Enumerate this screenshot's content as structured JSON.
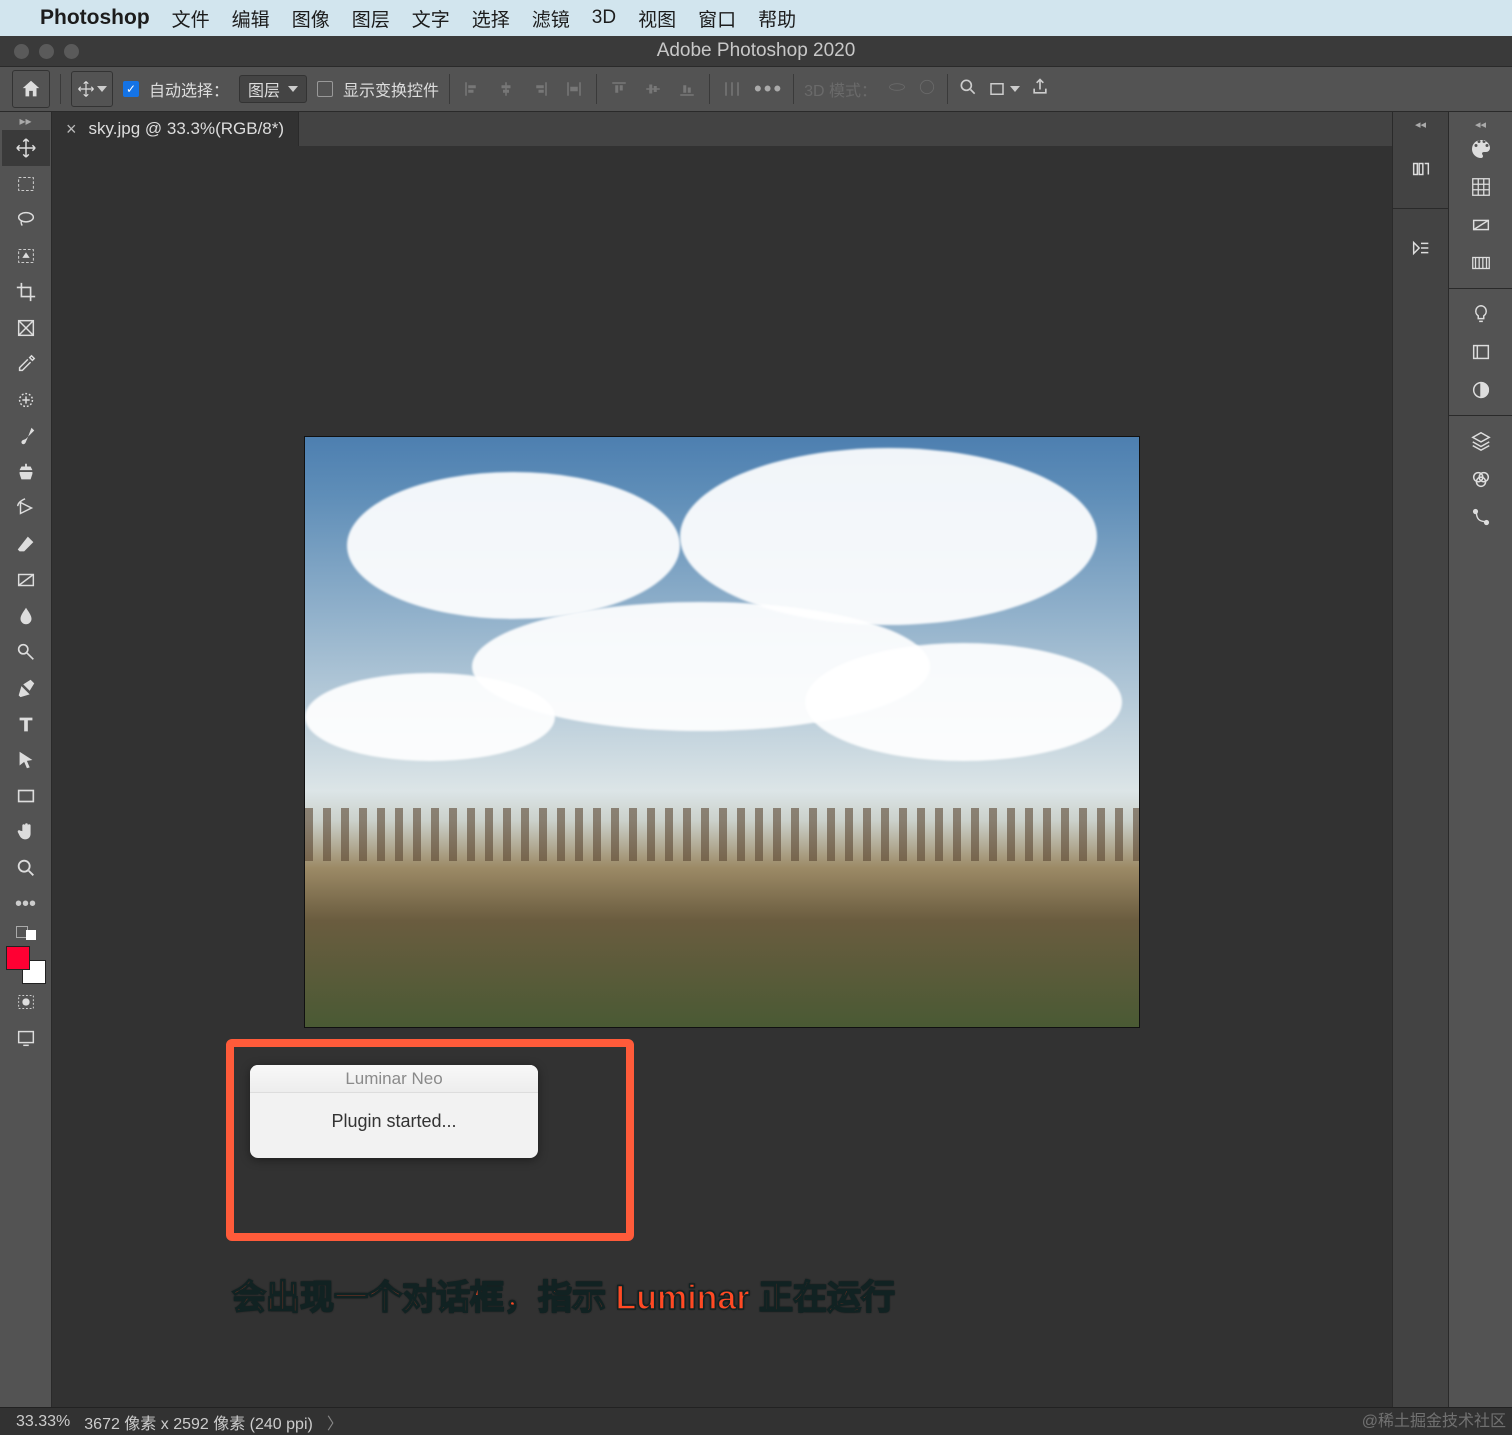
{
  "mac_menu": {
    "app_name": "Photoshop",
    "items": [
      "文件",
      "编辑",
      "图像",
      "图层",
      "文字",
      "选择",
      "滤镜",
      "3D",
      "视图",
      "窗口",
      "帮助"
    ]
  },
  "window": {
    "title": "Adobe Photoshop 2020"
  },
  "options_bar": {
    "auto_select_label": "自动选择：",
    "auto_select_target": "图层",
    "show_transform": "显示变换控件",
    "mode_3d": "3D 模式："
  },
  "document_tab": {
    "label": "sky.jpg @ 33.3%(RGB/8*)",
    "close": "×"
  },
  "dialog": {
    "title": "Luminar Neo",
    "body": "Plugin started..."
  },
  "annotation": "会出现一个对话框，指示 Luminar 正在运行",
  "statusbar": {
    "zoom": "33.33%",
    "info": "3672 像素 x 2592 像素 (240 ppi)",
    "chevron": "〉"
  },
  "watermark": "@稀土掘金技术社区",
  "colors": {
    "highlight": "#ff5b3a",
    "fg": "#ff0033",
    "bg": "#ffffff"
  }
}
